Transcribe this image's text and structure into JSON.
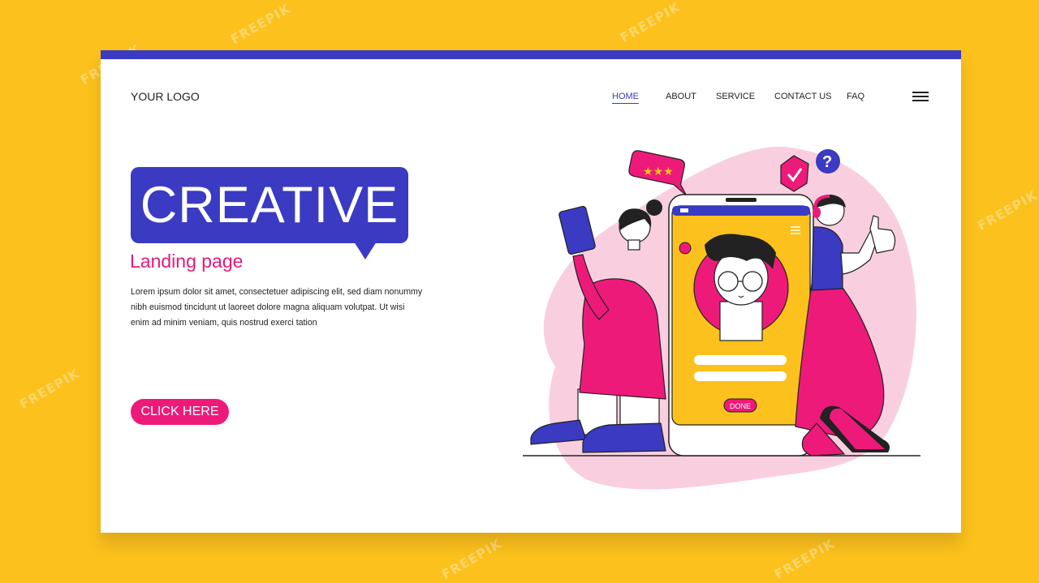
{
  "header": {
    "logo": "YOUR LOGO",
    "nav": [
      {
        "label": "HOME",
        "active": true
      },
      {
        "label": "ABOUT",
        "active": false
      },
      {
        "label": "SERVICE",
        "active": false
      },
      {
        "label": "CONTACT US",
        "active": false
      },
      {
        "label": "FAQ",
        "active": false
      }
    ],
    "menu_icon": "hamburger-menu-icon"
  },
  "hero": {
    "title": "CREATIVE",
    "subtitle": "Landing page",
    "description": "Lorem ipsum dolor sit amet, consectetuer adipiscing elit, sed diam nonummy nibh euismod tincidunt ut laoreet dolore magna aliquam volutpat. Ut wisi enim ad minim veniam, quis nostrud exerci tation",
    "cta_label": "CLICK HERE"
  },
  "illustration": {
    "phone_button_label": "DONE",
    "rating_stars": 3,
    "question_mark": "?"
  },
  "watermark": "FREEPIK",
  "colors": {
    "background": "#FCC11C",
    "primary": "#3A3AC2",
    "accent": "#EE1A7A",
    "blob": "#F9CFE0",
    "phone_screen": "#FCC11C"
  }
}
